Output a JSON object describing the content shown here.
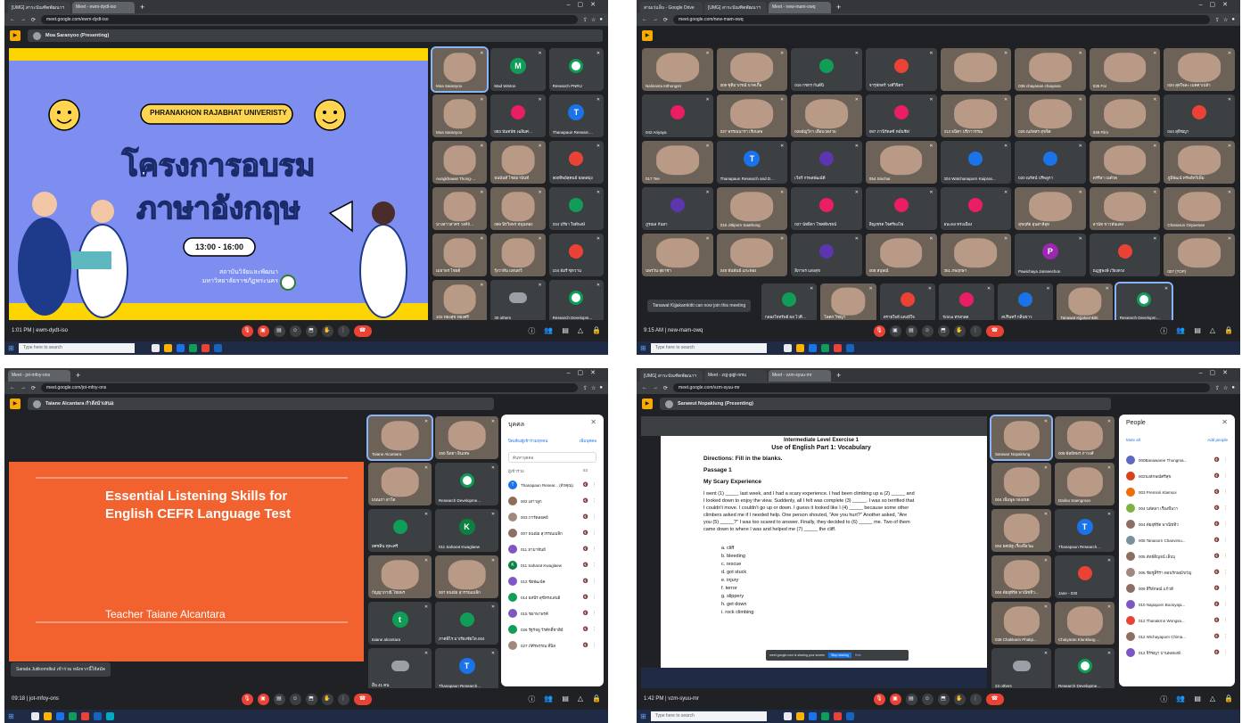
{
  "quad1": {
    "tabs": [
      "[UMG] สาระบัณฑิตพัฒนาฯ",
      "Meet - ewm-dydt-iso"
    ],
    "url": "meet.google.com/ewm-dydt-iso",
    "presenter": "Moa Saranyoo (Presenting)",
    "slide": {
      "university": "PHRANAKHON RAJABHAT UNIVERISTY",
      "title_line1": "โครงการอบรม",
      "title_line2": "ภาษาอังกฤษ",
      "time": "13:00 - 16:00",
      "org_line1": "สถาบันวิจัยและพัฒนา",
      "org_line2": "มหาวิทยาลัยราชภัฏพระนคร"
    },
    "tiles": [
      {
        "name": "Moa Saranyoo",
        "kind": "photo",
        "avatar": "",
        "color": ""
      },
      {
        "name": "Mad Winton",
        "kind": "letter",
        "avatar": "M",
        "color": "#0f9d58"
      },
      {
        "name": "Research PNRU",
        "kind": "logo",
        "avatar": "",
        "color": ""
      },
      {
        "name": "Moa Saranyoo",
        "kind": "photo",
        "avatar": "",
        "color": ""
      },
      {
        "name": "083 นันทนัช เฉลิมศรีพัฒน์",
        "kind": "blob",
        "avatar": "",
        "color": "#e91e63"
      },
      {
        "name": "Thanapaun Research...",
        "kind": "letter",
        "avatar": "T",
        "color": "#1a73e8"
      },
      {
        "name": "Aungkhawat Thong-...",
        "kind": "photo",
        "avatar": "",
        "color": ""
      },
      {
        "name": "ธนนันท์ ไชยมานันท์",
        "kind": "photo",
        "avatar": "",
        "color": ""
      },
      {
        "name": "900ทิพย์สุคนธ์ ยอดสมุ่ง",
        "kind": "blob",
        "avatar": "",
        "color": "#ea4335"
      },
      {
        "name": "นางสาวสาคร วงค์จันทร์",
        "kind": "photo",
        "avatar": "",
        "color": ""
      },
      {
        "name": "099 นิรวิลพร หนุนทอง",
        "kind": "photo",
        "avatar": "",
        "color": ""
      },
      {
        "name": "034 ปรียา ใจดีพงษ์",
        "kind": "blob",
        "avatar": "",
        "color": "#0f9d58"
      },
      {
        "name": "เมธาพร ไชยดี",
        "kind": "photo",
        "avatar": "",
        "color": ""
      },
      {
        "name": "รุ้งวาลีน แทนทวี",
        "kind": "photo",
        "avatar": "",
        "color": ""
      },
      {
        "name": "104 อัมรี ซุหวาน",
        "kind": "blob",
        "avatar": "",
        "color": "#ea4335"
      },
      {
        "name": "102 ทองสุข ทองศรี",
        "kind": "photo",
        "avatar": "",
        "color": ""
      },
      {
        "name": "30 others",
        "kind": "others",
        "avatar": "",
        "color": ""
      },
      {
        "name": "Research Developm...",
        "kind": "logo",
        "avatar": "",
        "color": ""
      }
    ],
    "meeting": "1:01 PM | ewm-dydt-iso",
    "search": "Type here to search"
  },
  "quad2": {
    "tabs": [
      "สามเร่แล็บ - Google Drive",
      "[UMG] สาระบัณฑิตพัฒนาฯ",
      "Meet - new-mam-owq"
    ],
    "url": "meet.google.com/new-mam-owq",
    "tiles": [
      {
        "name": "Nalinanta Inthongsri",
        "kind": "photo",
        "avatar": "",
        "color": ""
      },
      {
        "name": "009 ชุติมาภรณ์ นาคเกื้อ",
        "kind": "photo",
        "avatar": "",
        "color": ""
      },
      {
        "name": "016 กชกร กันต์นิ",
        "kind": "blob",
        "avatar": "",
        "color": "#0f9d58"
      },
      {
        "name": "จารุพักตร์ วงศ์วิจิตร",
        "kind": "blob",
        "avatar": "",
        "color": "#ea4335"
      },
      {
        "name": "",
        "kind": "photo",
        "avatar": "",
        "color": ""
      },
      {
        "name": "036 chayanan chaiyana",
        "kind": "photo",
        "avatar": "",
        "color": ""
      },
      {
        "name": "035 Fai",
        "kind": "photo",
        "avatar": "",
        "color": ""
      },
      {
        "name": "034 สุดใจละ เมตตาเปล้า",
        "kind": "photo",
        "avatar": "",
        "color": ""
      },
      {
        "name": "042 Ariyaya",
        "kind": "blob",
        "avatar": "",
        "color": "#e91e63"
      },
      {
        "name": "037 พรรณนารา เรียบลพ",
        "kind": "photo",
        "avatar": "",
        "color": ""
      },
      {
        "name": "026อัญวิกา เดือนวดงาม",
        "kind": "photo",
        "avatar": "",
        "color": ""
      },
      {
        "name": "087 ภานิรัดลซ์ หมั่นชีฟ",
        "kind": "blob",
        "avatar": "",
        "color": "#e91e63"
      },
      {
        "name": "013 ธนิตา ปรีภาวรรณ",
        "kind": "photo",
        "avatar": "",
        "color": ""
      },
      {
        "name": "025 ณภัสสร สุขจิต",
        "kind": "photo",
        "avatar": "",
        "color": ""
      },
      {
        "name": "049 Film",
        "kind": "photo",
        "avatar": "",
        "color": ""
      },
      {
        "name": "044 สุทิชญา",
        "kind": "blob",
        "avatar": "",
        "color": "#ea4335"
      },
      {
        "name": "017 Tee",
        "kind": "photo",
        "avatar": "",
        "color": ""
      },
      {
        "name": "Thanapaun Research and D...",
        "kind": "letter",
        "avatar": "T",
        "color": "#1a73e8"
      },
      {
        "name": "เวียร์ กรพลพัฒน์ดี",
        "kind": "blob",
        "avatar": "",
        "color": "#5e35b1"
      },
      {
        "name": "054 Sinchai",
        "kind": "photo",
        "avatar": "",
        "color": ""
      },
      {
        "name": "004 Watchanaporn Kaipras...",
        "kind": "blob",
        "avatar": "",
        "color": "#1a73e8"
      },
      {
        "name": "020 ณรัตน์ ปรีพลูกา",
        "kind": "blob",
        "avatar": "",
        "color": "#1a73e8"
      },
      {
        "name": "พรรีลา เนตัวด",
        "kind": "photo",
        "avatar": "",
        "color": ""
      },
      {
        "name": "ภูมิพัฒน์ ทรัพย์ทวีเพิ่ม",
        "kind": "photo",
        "avatar": "",
        "color": ""
      },
      {
        "name": "ภูรณล กันยา",
        "kind": "blob",
        "avatar": "",
        "color": "#5e35b1"
      },
      {
        "name": "016 Jittiporn Saathong",
        "kind": "photo",
        "avatar": "",
        "color": ""
      },
      {
        "name": "027 นัทธิดา โชคดีพรธน์",
        "kind": "blob",
        "avatar": "",
        "color": "#e91e63"
      },
      {
        "name": "สิญเชรด ใจศรีพงไฟ",
        "kind": "blob",
        "avatar": "",
        "color": "#e91e63"
      },
      {
        "name": "ธนะพง ทรงเมือง",
        "kind": "blob",
        "avatar": "",
        "color": "#e91e63"
      },
      {
        "name": "สุขฤทัย อุนสาลีอุท",
        "kind": "photo",
        "avatar": "",
        "color": ""
      },
      {
        "name": "ลานัท ขาวสันแดง",
        "kind": "photo",
        "avatar": "",
        "color": ""
      },
      {
        "name": "Chanarun Onpuesan",
        "kind": "photo",
        "avatar": "",
        "color": ""
      },
      {
        "name": "นพรวัน สุธาชา",
        "kind": "photo",
        "avatar": "",
        "color": ""
      },
      {
        "name": "048 พันพันธ์ แกะทอง",
        "kind": "photo",
        "avatar": "",
        "color": ""
      },
      {
        "name": "สิภาพร แสงสุข",
        "kind": "blob",
        "avatar": "",
        "color": "#5e35b1"
      },
      {
        "name": "008 สบุษณ์",
        "kind": "photo",
        "avatar": "",
        "color": ""
      },
      {
        "name": "051 ภพฤกษา",
        "kind": "photo",
        "avatar": "",
        "color": ""
      },
      {
        "name": "Pawichaya Janseechon",
        "kind": "letter",
        "avatar": "P",
        "color": "#9c27b0"
      },
      {
        "name": "ณฏฐพงษ์ เวียงดวง",
        "kind": "blob",
        "avatar": "",
        "color": "#ea4335"
      },
      {
        "name": "007 (TOP)",
        "kind": "photo",
        "avatar": "",
        "color": ""
      }
    ],
    "row5": [
      {
        "name": "กลองใจทรัพย์ ผล ไวศิษฐ์ 003",
        "kind": "blob",
        "avatar": "",
        "color": "#0f9d58"
      },
      {
        "name": "โลตก วิชญา",
        "kind": "photo",
        "avatar": "",
        "color": ""
      },
      {
        "name": "ทรายใจลี แตงมีใจ",
        "kind": "blob",
        "avatar": "",
        "color": "#ea4335"
      },
      {
        "name": "Tirima ทรงกลด",
        "kind": "blob",
        "avatar": "",
        "color": "#e91e63"
      },
      {
        "name": "สปรินทร์ กลิ่นขาว",
        "kind": "blob",
        "avatar": "",
        "color": "#1a73e8"
      },
      {
        "name": "Tanawat Kijjakarnkitti",
        "kind": "photo",
        "avatar": "",
        "color": ""
      },
      {
        "name": "Research Development PN...",
        "kind": "logo",
        "avatar": "",
        "color": ""
      }
    ],
    "toast": "Tanawat Kijjakarnkitti can now join this meeting",
    "meeting": "9:15 AM | new-mam-owq",
    "search": "Type here to search"
  },
  "quad3": {
    "tabs": [
      "Meet - jot-mfoy-ons"
    ],
    "url": "meet.google.com/jot-mfoy-ons",
    "presenter": "Taiane Alcantara กำลังนำเสนอ",
    "slide": {
      "title_line1": "Essential Listening Skills for",
      "title_line2": "English CEFR Language Test",
      "teacher": "Teacher Taiane Alcantara"
    },
    "tiles": [
      {
        "name": "Taiane Alcantara",
        "kind": "photo",
        "avatar": "",
        "color": ""
      },
      {
        "name": "250 นิลยา อินเทพ",
        "kind": "photo",
        "avatar": "",
        "color": ""
      },
      {
        "name": "มนนภา สาโต",
        "kind": "photo",
        "avatar": "",
        "color": ""
      },
      {
        "name": "Research Developme...",
        "kind": "logo",
        "avatar": "",
        "color": ""
      },
      {
        "name": "ยศชลิน ทุหะศรี",
        "kind": "blob",
        "avatar": "",
        "color": "#0f9d58"
      },
      {
        "name": "011 Saharat Kwaglaew",
        "kind": "letter",
        "avatar": "K",
        "color": "#0b8043"
      },
      {
        "name": "กัญญาภาณี ไชยพร",
        "kind": "photo",
        "avatar": "",
        "color": ""
      },
      {
        "name": "007 ธนณัย สุวรรณเมลิก",
        "kind": "photo",
        "avatar": "",
        "color": ""
      },
      {
        "name": "taiane alcantara",
        "kind": "letter",
        "avatar": "t",
        "color": "#0f9d58"
      },
      {
        "name": "ภาคพิไร มาเรียงชัยโต.004",
        "kind": "blob",
        "avatar": "",
        "color": "#0f9d58"
      },
      {
        "name": "อื่น 41 คน",
        "kind": "others",
        "avatar": "",
        "color": ""
      },
      {
        "name": "Thanapaun Research...",
        "kind": "letter",
        "avatar": "T",
        "color": "#1a73e8"
      }
    ],
    "panel": {
      "title": "บุคคล",
      "add": "เพิ่มบุคคล",
      "mute": "ปิดเสียงผู้เข้าร่วมทุกคน",
      "search": "ค้นหาบุคคล",
      "section": "ผู้เข้าร่วม",
      "count": "53",
      "people": [
        {
          "name": "Thanapaun Resear... (ตัวคุณ)",
          "avatar": "T",
          "color": "#1a73e8"
        },
        {
          "name": "002 เสาวลูก",
          "avatar": "",
          "color": "#8e6e5a"
        },
        {
          "name": "003 ภารัตลยคย์",
          "avatar": "",
          "color": "#a1887f"
        },
        {
          "name": "007 ธนณัย สุวรรณเมลิก",
          "avatar": "",
          "color": "#8d6e63"
        },
        {
          "name": "011 ยามาทันย์",
          "avatar": "",
          "color": "#7e57c2"
        },
        {
          "name": "011 Saharat Kwaglaew",
          "avatar": "K",
          "color": "#0b8043"
        },
        {
          "name": "012 ชัยพัฒน์ค",
          "avatar": "",
          "color": "#7e57c2"
        },
        {
          "name": "014 ยสนีร สุขีทรงเสนย์",
          "avatar": "",
          "color": "#0f9d58"
        },
        {
          "name": "015 ชยาพาพรค์",
          "avatar": "",
          "color": "#7e57c2"
        },
        {
          "name": "026 รัฐรัจพู่ วีรศักดิ์ชาติย์",
          "avatar": "",
          "color": "#0f9d58"
        },
        {
          "name": "027 ภัคีรพรรณ สี่นิส",
          "avatar": "",
          "color": "#a1887f"
        }
      ]
    },
    "toast": "Sarada Jutikorndkul เข้าร่วม หลังจากนี้ให้สมัค",
    "meeting": "09:18 | jot-mfoy-ons",
    "search": ""
  },
  "quad4": {
    "tabs": [
      "[UMG] สาระบัณฑิตพัฒนาฯ",
      "Meet - zqj-gqjt-nmu",
      "Meet - vzm-syuu-mr"
    ],
    "url": "meet.google.com/vzm-syuu-mr",
    "presenter": "Sarawut Nopaklung (Presenting)",
    "slide": {
      "header1": "Intermediate Level Exercise 1",
      "header2": "Use of English Part 1: Vocabulary",
      "directions": "Directions: Fill in the blanks.",
      "passage": "Passage 1",
      "story_title": "My Scary Experience",
      "para": [
        "I went (1) _____ last week, and I had a scary experience. I had been climbing up a (2) _____ and",
        "I looked down to enjoy the view. Suddenly, all I felt was complete (3) _____. I was so terrified that",
        "I couldn't move. I couldn't go up or down. I guess it looked like I (4) _____ because some other",
        "climbers asked me if I needed help. One person shouted, \"Are you hurt?\" Another asked, \"Are",
        "you (5) _____?\" I was too scared to answer. Finally, they decided to (6) _____ me. Two of them",
        "came down to where I was and helped me (7) _____ the cliff."
      ],
      "options": [
        "a.  cliff",
        "b.  bleeding",
        "c.  rescue",
        "d.  got stuck",
        "e.  injury",
        "f.  terror",
        "g.  slippery",
        "h.  get down",
        "i.   rock climbing"
      ]
    },
    "tiles": [
      {
        "name": "Sarawut Nopaklung",
        "kind": "photo",
        "avatar": "",
        "color": ""
      },
      {
        "name": "008 ผัลย์ทพร ภาวงศ์",
        "kind": "photo",
        "avatar": "",
        "color": ""
      },
      {
        "name": "004 เพิ่มพูล กองเขต",
        "kind": "photo",
        "avatar": "",
        "color": ""
      },
      {
        "name": "Dariko Saengmon",
        "kind": "photo",
        "avatar": "",
        "color": ""
      },
      {
        "name": "004 ยศณัฐ เรื่องลือวัฒ",
        "kind": "photo",
        "avatar": "",
        "color": ""
      },
      {
        "name": "Thanapaun Research...",
        "kind": "letter",
        "avatar": "T",
        "color": "#1a73e8"
      },
      {
        "name": "004 ดัยยุพีรัต พาณิชทิว...",
        "kind": "photo",
        "avatar": "",
        "color": ""
      },
      {
        "name": "Jane - 030",
        "kind": "blob",
        "avatar": "",
        "color": "#ea4335"
      },
      {
        "name": "038 Chakkarin Phakp...",
        "kind": "photo",
        "avatar": "",
        "color": ""
      },
      {
        "name": "Chaiyaran Klanklang ...",
        "kind": "photo",
        "avatar": "",
        "color": ""
      },
      {
        "name": "23 others",
        "kind": "others",
        "avatar": "",
        "color": ""
      },
      {
        "name": "Research Developme...",
        "kind": "logo",
        "avatar": "",
        "color": ""
      }
    ],
    "panel": {
      "title": "People",
      "add": "Add people",
      "mute": "Mute all",
      "people": [
        {
          "name": "000Banawaree Thongma...",
          "avatar": "",
          "color": "#5c6bc0"
        },
        {
          "name": "002นงลักษณ์ศรีสุข",
          "avatar": "",
          "color": "#d84315"
        },
        {
          "name": "003 Premsiri Klamsoi",
          "avatar": "",
          "color": "#ef6c00"
        },
        {
          "name": "004 นพัดลา เรืองพืนวา",
          "avatar": "",
          "color": "#7cb342"
        },
        {
          "name": "004 ดัยยุพีรัต พาณิชทิว",
          "avatar": "",
          "color": "#8d6e63"
        },
        {
          "name": "005 Tanasorn Chanvimu...",
          "avatar": "",
          "color": "#78909c"
        },
        {
          "name": "005 ลัทธ์ดิญจน์ เล็บบุ",
          "avatar": "",
          "color": "#8d6e63"
        },
        {
          "name": "006 ชัยชูล็รีร่า ดอนรักษณ์ขวัญ",
          "avatar": "",
          "color": "#a1887f"
        },
        {
          "name": "009 สิริลักษณ์ แก้วดี",
          "avatar": "",
          "color": "#8d6e63"
        },
        {
          "name": "010 Napaporn Boonyaja...",
          "avatar": "",
          "color": "#7e57c2"
        },
        {
          "name": "012 Thanakrnn Wongsa...",
          "avatar": "",
          "color": "#ea4335"
        },
        {
          "name": "012 Wichayaporn Chima...",
          "avatar": "",
          "color": "#8d6e63"
        },
        {
          "name": "012 จิรัชญา ปานพลพงษ์",
          "avatar": "",
          "color": "#7e57c2"
        }
      ]
    },
    "banner": "meet.google.com is sharing your screen",
    "banner_btn1": "Stop sharing",
    "banner_btn2": "Hide",
    "meeting": "1:42 PM | vzm-syuu-mr",
    "search": "Type here to search"
  }
}
